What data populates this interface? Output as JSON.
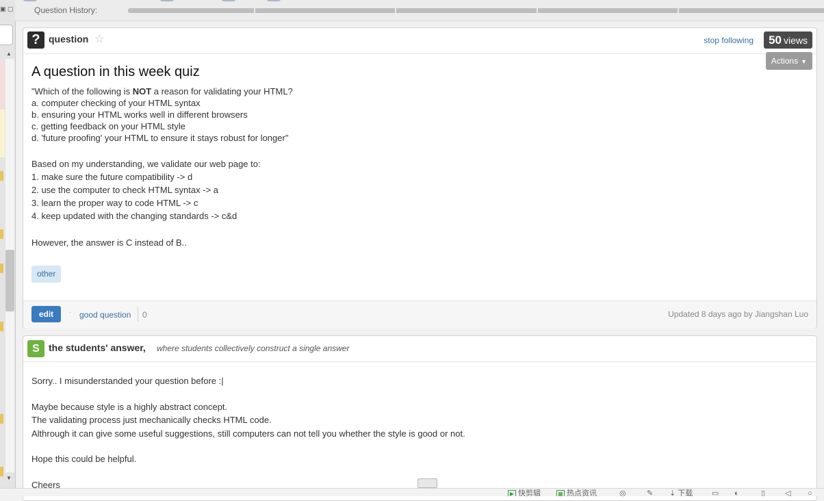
{
  "history": {
    "label": "Question History:"
  },
  "question": {
    "type_label": "question",
    "stop_following": "stop following",
    "views_count": "50",
    "views_label": "views",
    "actions_label": "Actions",
    "title": "A question in this week quiz",
    "body_lines_1": [
      {
        "pre": "\"Which of the following is ",
        "bold": "NOT",
        "post": " a reason for validating your HTML?"
      },
      {
        "pre": "a. computer checking of your HTML syntax",
        "bold": "",
        "post": ""
      },
      {
        "pre": "b. ensuring your HTML works well in different browsers",
        "bold": "",
        "post": ""
      },
      {
        "pre": "c. getting feedback on your HTML style",
        "bold": "",
        "post": ""
      },
      {
        "pre": "d. 'future proofing' your HTML to ensure it stays robust for longer\"",
        "bold": "",
        "post": ""
      }
    ],
    "body_lines_2": [
      "Based on my understanding, we validate our web page to:",
      "1. make sure the future compatibility -> d",
      "2. use the computer to check HTML syntax -> a",
      "3. learn the proper way to code HTML -> c",
      "4. keep updated with the changing standards -> c&d"
    ],
    "body_line_3": "However, the answer is C instead of B..",
    "tag": "other",
    "edit_label": "edit",
    "good_question_label": "good question",
    "good_question_count": "0",
    "updated_text": "Updated 8 days ago by Jiangshan Luo"
  },
  "answer": {
    "icon_letter": "S",
    "title": "the students' answer,",
    "subtitle": "where students collectively construct a single answer",
    "lines": [
      "Sorry.. I misunderstanded your question before :|",
      "",
      "Maybe because style is a highly abstract concept.",
      "The validating process just mechanically checks HTML code.",
      "Althrough it can give some useful suggestions, still computers can not tell you whether the style is good or not.",
      "",
      "Hope this could be helpful.",
      "",
      "Cheers"
    ]
  },
  "statusbar": {
    "items": [
      "快剪辑",
      "热点资讯",
      "下载"
    ]
  }
}
